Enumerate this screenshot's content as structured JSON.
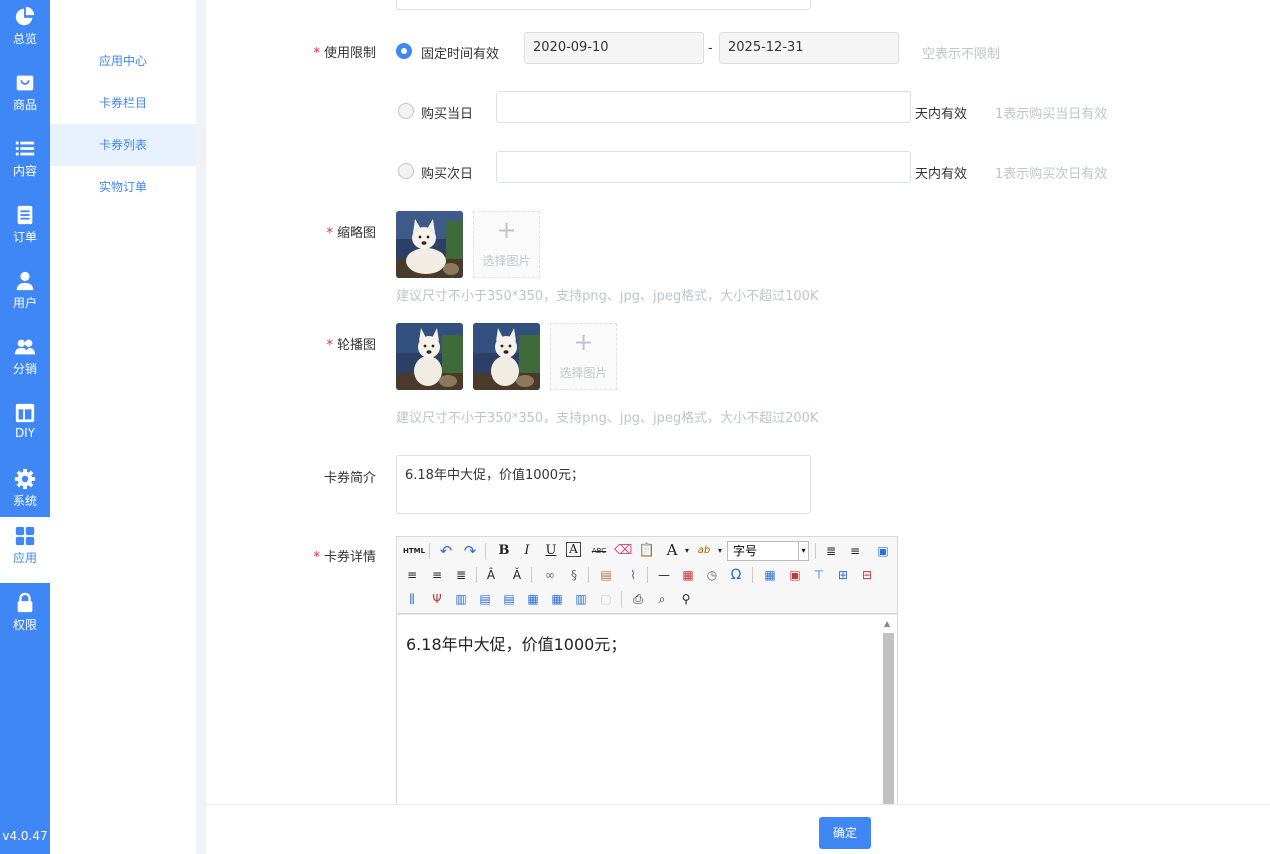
{
  "nav": {
    "items": [
      {
        "label": "总览",
        "icon": "pie-chart-icon"
      },
      {
        "label": "商品",
        "icon": "shopping-bag-icon"
      },
      {
        "label": "内容",
        "icon": "list-icon"
      },
      {
        "label": "订单",
        "icon": "document-icon"
      },
      {
        "label": "用户",
        "icon": "user-icon"
      },
      {
        "label": "分销",
        "icon": "users-icon"
      },
      {
        "label": "DIY",
        "icon": "layout-icon"
      },
      {
        "label": "系统",
        "icon": "gear-icon"
      },
      {
        "label": "应用",
        "icon": "apps-grid-icon"
      },
      {
        "label": "权限",
        "icon": "lock-icon"
      }
    ],
    "active": "应用",
    "version": "v4.0.47"
  },
  "submenu": {
    "items": [
      {
        "label": "应用中心"
      },
      {
        "label": "卡券栏目"
      },
      {
        "label": "卡券列表"
      },
      {
        "label": "实物订单"
      }
    ],
    "active": "卡券列表"
  },
  "form": {
    "usage_limit": {
      "label": "使用限制",
      "fixed": {
        "label": "固定时间有效",
        "start": "2020-09-10",
        "end": "2025-12-31",
        "separator": "-",
        "hint": "空表示不限制",
        "selected": true
      },
      "same_day": {
        "label": "购买当日",
        "value": "",
        "suffix": "天内有效",
        "hint": "1表示购买当日有效",
        "selected": false
      },
      "next_day": {
        "label": "购买次日",
        "value": "",
        "suffix": "天内有效",
        "hint": "1表示购买次日有效",
        "selected": false
      }
    },
    "thumbnail": {
      "label": "缩略图",
      "upload_label": "选择图片",
      "hint": "建议尺寸不小于350*350，支持png、jpg、jpeg格式，大小不超过100K"
    },
    "carousel": {
      "label": "轮播图",
      "upload_label": "选择图片",
      "hint": "建议尺寸不小于350*350，支持png、jpg、jpeg格式，大小不超过200K"
    },
    "intro": {
      "label": "卡券简介",
      "value": "6.18年中大促，价值1000元；"
    },
    "details": {
      "label": "卡券详情",
      "content": "6.18年中大促，价值1000元；",
      "toolbar": {
        "html_label": "HTML",
        "font_size_placeholder": "字号",
        "bold": "B",
        "italic": "I",
        "underline": "U",
        "strike": "ABC",
        "font_color": "A",
        "omega": "Ω"
      }
    }
  },
  "footer": {
    "confirm_label": "确定"
  },
  "colors": {
    "primary": "#3f87f5",
    "required": "#f5222d",
    "hint": "#c0c4cc"
  }
}
